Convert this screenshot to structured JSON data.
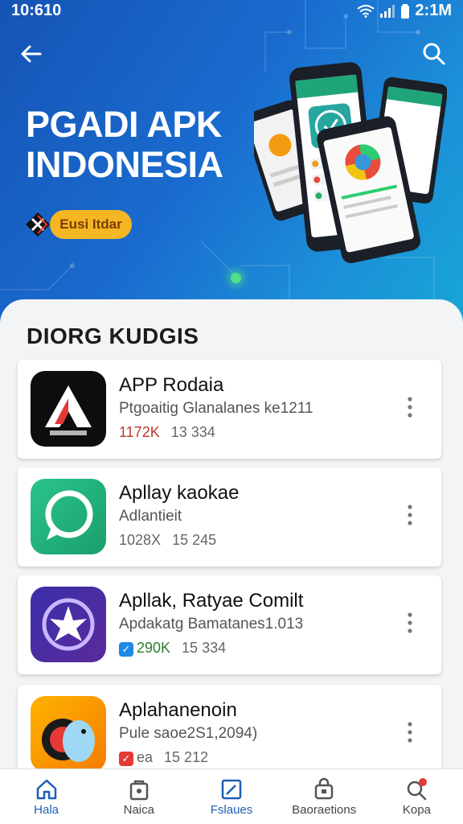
{
  "status_bar": {
    "time": "10:610",
    "clock": "2:1M"
  },
  "hero": {
    "title_line1": "PGADI APK",
    "title_line2": "INDONESIA",
    "badge_label": "Eusi Itdar"
  },
  "section": {
    "title": "DIORG KUDGIS"
  },
  "apps": [
    {
      "name": "APP Rodaia",
      "subtitle": "Ptgoaitig Glanalanes ke1211",
      "downloads": "1172K",
      "size": "13 334"
    },
    {
      "name": "Apllay kaokae",
      "subtitle": "Adlantieit",
      "downloads": "1028X",
      "size": "15 245"
    },
    {
      "name": "Apllak, Ratyae Comilt",
      "subtitle": "Apdakatg Bamatanes1.013",
      "downloads": "290K",
      "size": "15 334"
    },
    {
      "name": "Aplahanenoin",
      "subtitle": "Pule saoe2S1,2094)",
      "downloads": "ea",
      "size": "15 212"
    }
  ],
  "nav": [
    {
      "label": "Hala",
      "icon": "home-icon"
    },
    {
      "label": "Naica",
      "icon": "store-icon"
    },
    {
      "label": "Fslaues",
      "icon": "edit-icon"
    },
    {
      "label": "Baoraetions",
      "icon": "bag-icon"
    },
    {
      "label": "Kopa",
      "icon": "search-icon"
    }
  ],
  "colors": {
    "hero_start": "#1554b5",
    "hero_end": "#18a6d6",
    "accent_pill": "#f5b623",
    "nav_active": "#1a5fb4",
    "notification": "#e53935"
  }
}
